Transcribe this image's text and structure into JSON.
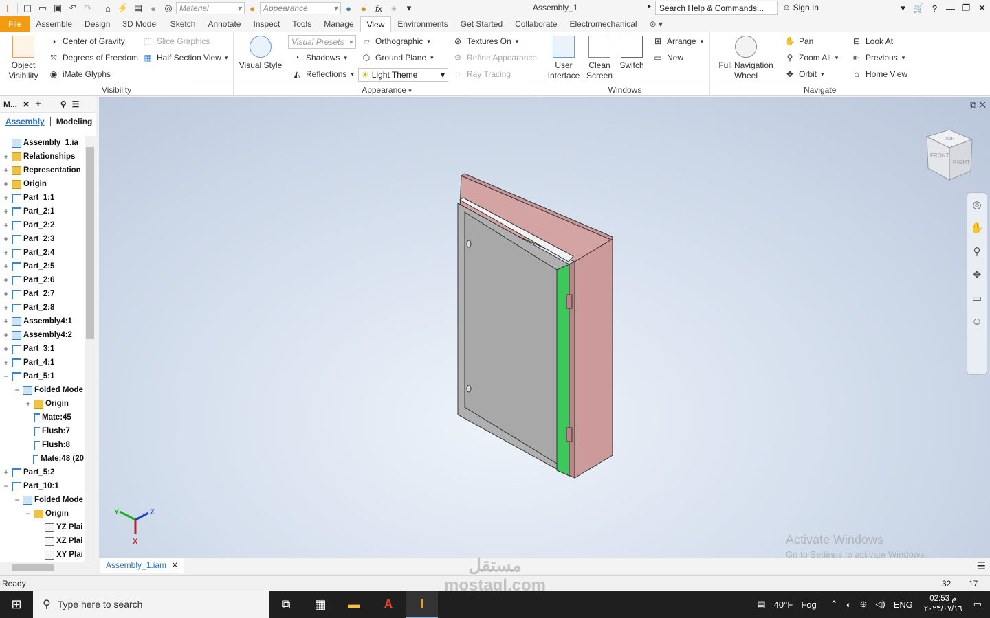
{
  "qat": {
    "material_placeholder": "Material",
    "appearance_placeholder": "Appearance",
    "title": "Assembly_1",
    "help_search": "Search Help & Commands...",
    "signin": "Sign In"
  },
  "tabs": [
    {
      "label": "File"
    },
    {
      "label": "Assemble"
    },
    {
      "label": "Design"
    },
    {
      "label": "3D Model"
    },
    {
      "label": "Sketch"
    },
    {
      "label": "Annotate"
    },
    {
      "label": "Inspect"
    },
    {
      "label": "Tools"
    },
    {
      "label": "Manage"
    },
    {
      "label": "View"
    },
    {
      "label": "Environments"
    },
    {
      "label": "Get Started"
    },
    {
      "label": "Collaborate"
    },
    {
      "label": "Electromechanical"
    }
  ],
  "ribbon": {
    "visibility": {
      "object_visibility": "Object Visibility",
      "center_of_gravity": "Center of Gravity",
      "degrees_of_freedom": "Degrees of Freedom",
      "imate_glyphs": "iMate Glyphs",
      "slice_graphics": "Slice Graphics",
      "half_section_view": "Half Section View",
      "label": "Visibility"
    },
    "appearance": {
      "visual_style": "Visual Style",
      "visual_presets": "Visual Presets",
      "shadows": "Shadows",
      "reflections": "Reflections",
      "orthographic": "Orthographic",
      "ground_plane": "Ground Plane",
      "light_theme": "Light Theme",
      "textures_on": "Textures On",
      "refine_appearance": "Refine Appearance",
      "ray_tracing": "Ray Tracing",
      "label": "Appearance"
    },
    "windows": {
      "user_interface": "User Interface",
      "clean_screen": "Clean Screen",
      "switch": "Switch",
      "arrange": "Arrange",
      "new": "New",
      "label": "Windows"
    },
    "navigate": {
      "full_nav_wheel": "Full Navigation Wheel",
      "pan": "Pan",
      "zoom_all": "Zoom All",
      "orbit": "Orbit",
      "look_at": "Look At",
      "previous": "Previous",
      "home_view": "Home View",
      "label": "Navigate"
    }
  },
  "browser": {
    "header": "M...",
    "tab_assembly": "Assembly",
    "tab_modeling": "Modeling",
    "tree": [
      {
        "label": "Assembly_1.ia",
        "icon": "asm",
        "exp": "",
        "indent": 0
      },
      {
        "label": "Relationships",
        "icon": "folder",
        "exp": "+",
        "indent": 0
      },
      {
        "label": "Representation",
        "icon": "folder",
        "exp": "+",
        "indent": 0
      },
      {
        "label": "Origin",
        "icon": "folder",
        "exp": "+",
        "indent": 0
      },
      {
        "label": "Part_1:1",
        "icon": "part",
        "exp": "+",
        "indent": 0
      },
      {
        "label": "Part_2:1",
        "icon": "part",
        "exp": "+",
        "indent": 0
      },
      {
        "label": "Part_2:2",
        "icon": "part",
        "exp": "+",
        "indent": 0
      },
      {
        "label": "Part_2:3",
        "icon": "part",
        "exp": "+",
        "indent": 0
      },
      {
        "label": "Part_2:4",
        "icon": "part",
        "exp": "+",
        "indent": 0
      },
      {
        "label": "Part_2:5",
        "icon": "part",
        "exp": "+",
        "indent": 0
      },
      {
        "label": "Part_2:6",
        "icon": "part",
        "exp": "+",
        "indent": 0
      },
      {
        "label": "Part_2:7",
        "icon": "part",
        "exp": "+",
        "indent": 0
      },
      {
        "label": "Part_2:8",
        "icon": "part",
        "exp": "+",
        "indent": 0
      },
      {
        "label": "Assembly4:1",
        "icon": "asm",
        "exp": "+",
        "indent": 0
      },
      {
        "label": "Assembly4:2",
        "icon": "asm",
        "exp": "+",
        "indent": 0
      },
      {
        "label": "Part_3:1",
        "icon": "part",
        "exp": "+",
        "indent": 0
      },
      {
        "label": "Part_4:1",
        "icon": "part",
        "exp": "+",
        "indent": 0
      },
      {
        "label": "Part_5:1",
        "icon": "part",
        "exp": "−",
        "indent": 0
      },
      {
        "label": "Folded Mode",
        "icon": "asm",
        "exp": "−",
        "indent": 1
      },
      {
        "label": "Origin",
        "icon": "folder",
        "exp": "+",
        "indent": 2
      },
      {
        "label": "Mate:45",
        "icon": "constr",
        "exp": "",
        "indent": 2
      },
      {
        "label": "Flush:7",
        "icon": "constr",
        "exp": "",
        "indent": 2
      },
      {
        "label": "Flush:8",
        "icon": "constr",
        "exp": "",
        "indent": 2
      },
      {
        "label": "Mate:48 (20",
        "icon": "constr",
        "exp": "",
        "indent": 2
      },
      {
        "label": "Part_5:2",
        "icon": "part",
        "exp": "+",
        "indent": 0
      },
      {
        "label": "Part_10:1",
        "icon": "part",
        "exp": "−",
        "indent": 0
      },
      {
        "label": "Folded Mode",
        "icon": "asm",
        "exp": "−",
        "indent": 1
      },
      {
        "label": "Origin",
        "icon": "folder",
        "exp": "−",
        "indent": 2
      },
      {
        "label": "YZ Plai",
        "icon": "plane",
        "exp": "",
        "indent": 3
      },
      {
        "label": "XZ Plai",
        "icon": "plane",
        "exp": "",
        "indent": 3
      },
      {
        "label": "XY Plai",
        "icon": "plane",
        "exp": "",
        "indent": 3
      }
    ]
  },
  "viewcube": {
    "top": "TOP",
    "front": "FRONT",
    "right": "RIGHT"
  },
  "triad": {
    "x": "X",
    "y": "Y",
    "z": "Z"
  },
  "activate": {
    "line1": "Activate Windows",
    "line2": "Go to Settings to activate Windows."
  },
  "doc_tab": "Assembly_1.iam",
  "status": {
    "text": "Ready",
    "num1": "32",
    "num2": "17"
  },
  "taskbar": {
    "search": "Type here to search",
    "weather_temp": "40°F",
    "weather_text": "Fog",
    "lang": "ENG",
    "time": "02:53 م",
    "date": "٢٠٢٣/٠٧/١٦"
  },
  "watermark": {
    "line1": "مستقل",
    "line2": "mostaql.com"
  },
  "colors": {
    "file_tab": "#f39c12",
    "cabinet_body": "#d4a3a3",
    "door": "#a8a8a8",
    "door_hinge_strip": "#3cc85a"
  }
}
